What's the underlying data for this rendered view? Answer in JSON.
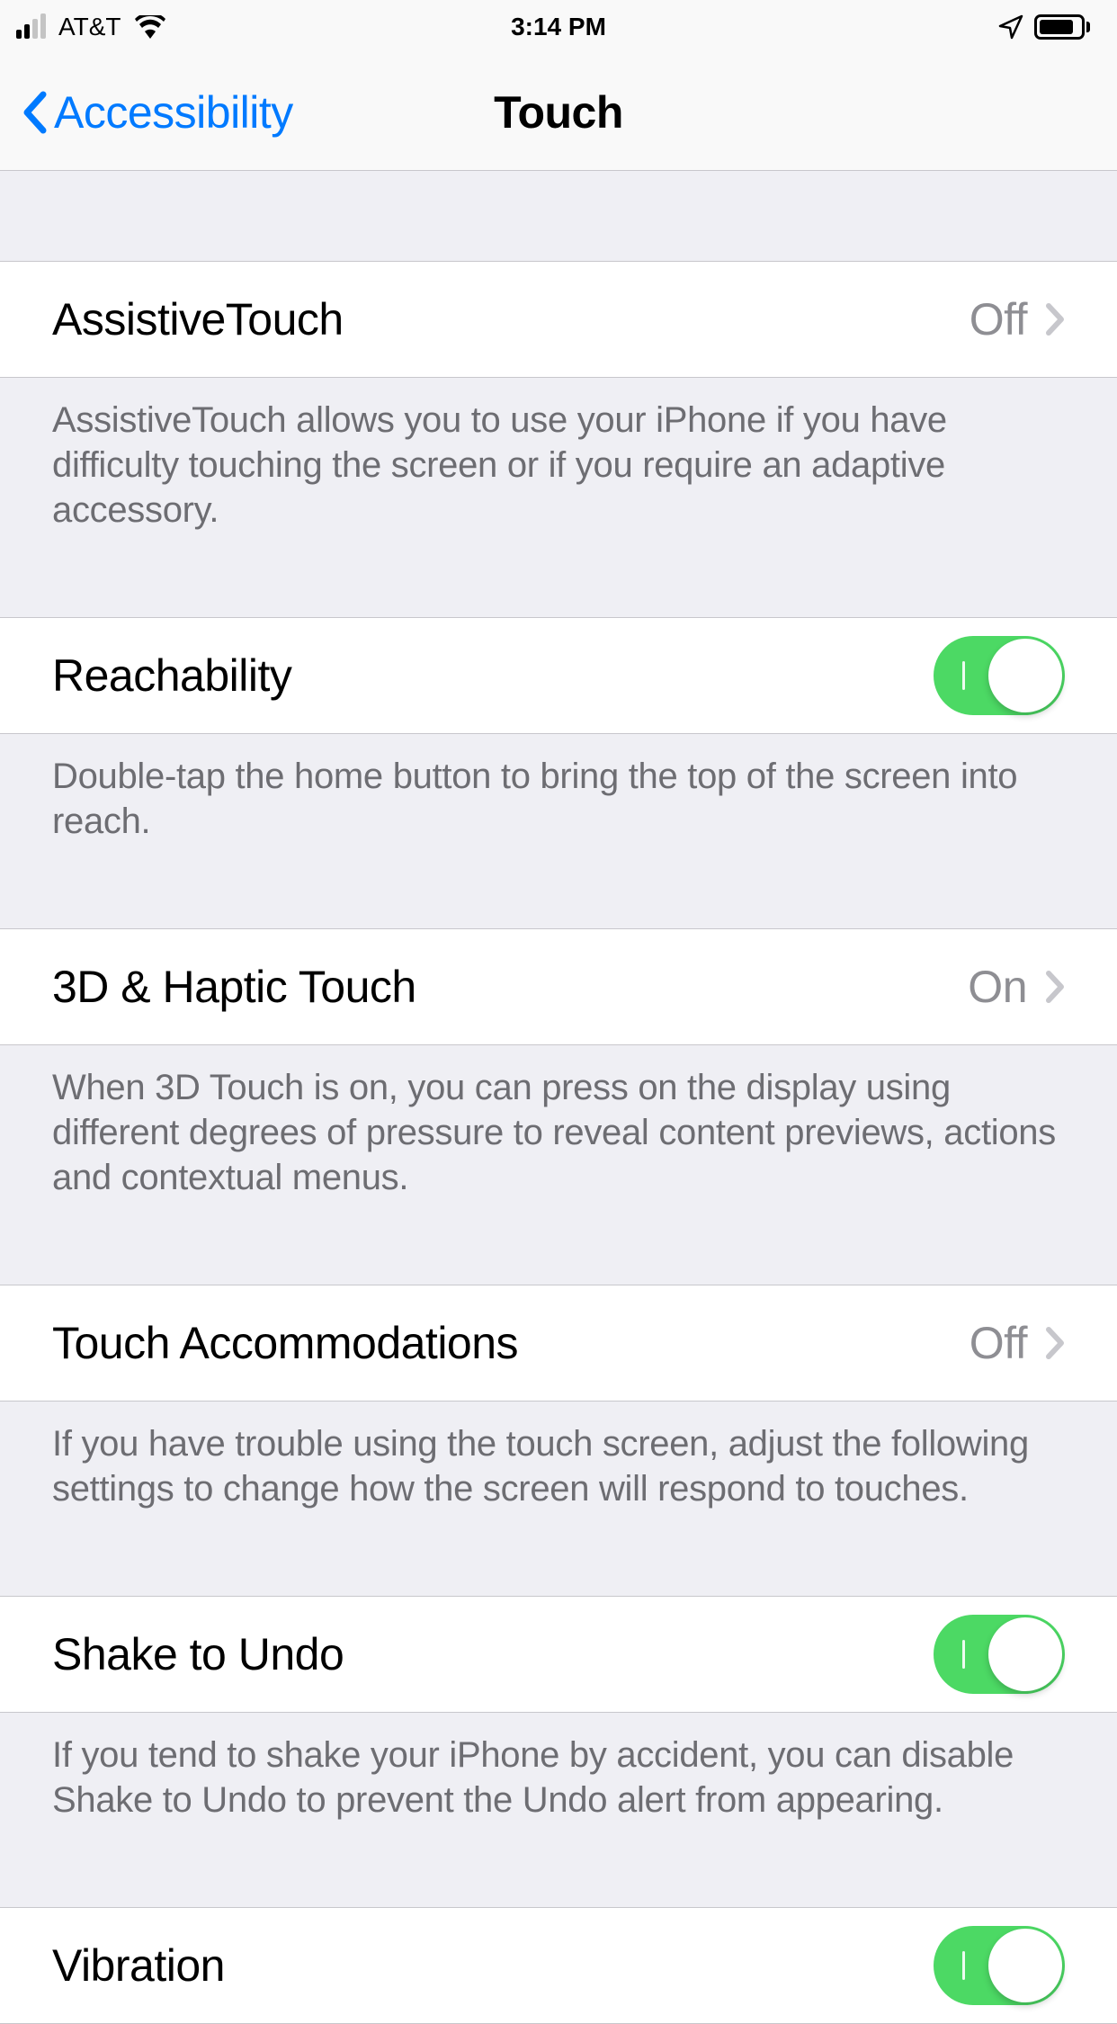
{
  "status_bar": {
    "carrier": "AT&T",
    "time": "3:14 PM"
  },
  "nav": {
    "back_label": "Accessibility",
    "title": "Touch"
  },
  "sections": {
    "assistive_touch": {
      "label": "AssistiveTouch",
      "value": "Off",
      "footer": "AssistiveTouch allows you to use your iPhone if you have difficulty touching the screen or if you require an adaptive accessory."
    },
    "reachability": {
      "label": "Reachability",
      "toggle": true,
      "footer": "Double-tap the home button to bring the top of the screen into reach."
    },
    "haptic_touch": {
      "label": "3D & Haptic Touch",
      "value": "On",
      "footer": "When 3D Touch is on, you can press on the display using different degrees of pressure to reveal content previews, actions and contextual menus."
    },
    "touch_accommodations": {
      "label": "Touch Accommodations",
      "value": "Off",
      "footer": "If you have trouble using the touch screen, adjust the following settings to change how the screen will respond to touches."
    },
    "shake_to_undo": {
      "label": "Shake to Undo",
      "toggle": true,
      "footer": "If you tend to shake your iPhone by accident, you can disable Shake to Undo to prevent the Undo alert from appearing."
    },
    "vibration": {
      "label": "Vibration",
      "toggle": true
    }
  }
}
